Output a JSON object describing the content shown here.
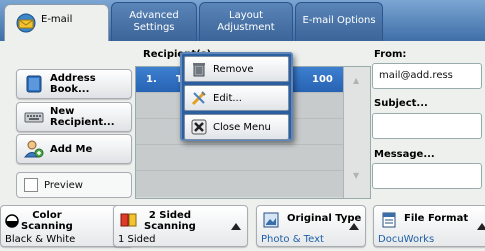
{
  "tabs": [
    {
      "label": "E-mail",
      "icon": "email-icon",
      "active": true
    },
    {
      "label": "Advanced\nSettings",
      "active": false
    },
    {
      "label": "Layout\nAdjustment",
      "active": false
    },
    {
      "label": "E-mail Options",
      "active": false
    }
  ],
  "sidebar": {
    "address_book": "Address\nBook...",
    "new_recipient": "New\nRecipient...",
    "add_me": "Add Me",
    "preview": "Preview"
  },
  "recipients": {
    "header": "Recipient(s)",
    "rows": [
      {
        "number": "1.",
        "name": "T",
        "suffix": "100"
      }
    ]
  },
  "from": {
    "label": "From:",
    "value": "mail@add.ress"
  },
  "subject": {
    "label": "Subject...",
    "value": ""
  },
  "message": {
    "label": "Message...",
    "value": ""
  },
  "context_menu": {
    "items": [
      "Remove",
      "Edit...",
      "Close Menu"
    ]
  },
  "bottom": {
    "color": {
      "title": "Color\nScanning",
      "value": "Black & White"
    },
    "sided": {
      "title": "2 Sided\nScanning",
      "value": "1 Sided"
    },
    "original": {
      "title": "Original Type",
      "value": "Photo & Text"
    },
    "format": {
      "title": "File Format",
      "value": "DocuWorks"
    }
  },
  "colors": {
    "tab_bar": "#3f6ea8",
    "selected_row": "#2763b3",
    "value_blue": "#1f5fa8"
  }
}
